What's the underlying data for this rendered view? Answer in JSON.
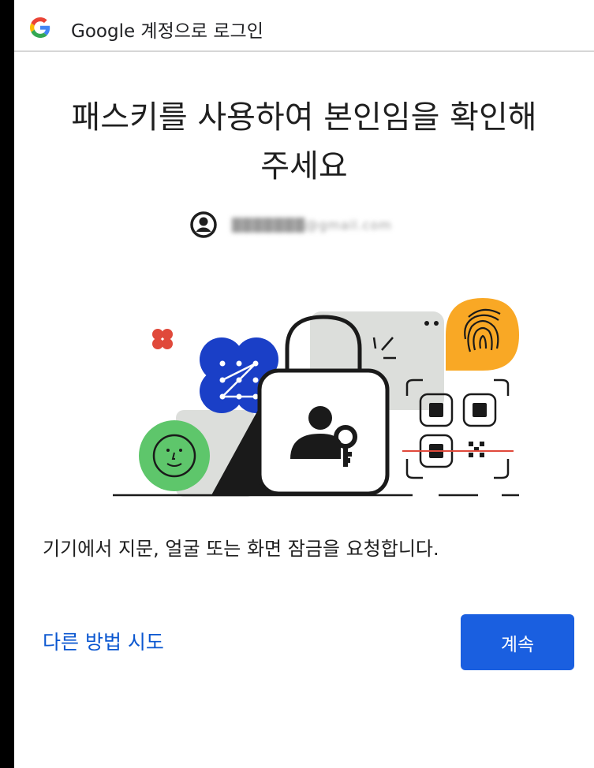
{
  "header": {
    "title": "Google 계정으로 로그인",
    "logo_icon": "google-g-icon"
  },
  "main": {
    "headline_line1": "패스키를 사용하여 본인임을 확인해",
    "headline_line2": "주세요",
    "account_icon": "account-circle-icon",
    "account_email": "███████@gmail.com",
    "description": "기기에서 지문, 얼굴 또는 화면 잠금을 요청합니다."
  },
  "actions": {
    "alt_label": "다른 방법 시도",
    "continue_label": "계속"
  },
  "colors": {
    "primary_button": "#1a5fe0",
    "link": "#0b57d0",
    "illustration_blue": "#1a3fc7",
    "illustration_green": "#5ec66b",
    "illustration_orange": "#f9a825",
    "illustration_red": "#e0493b"
  }
}
